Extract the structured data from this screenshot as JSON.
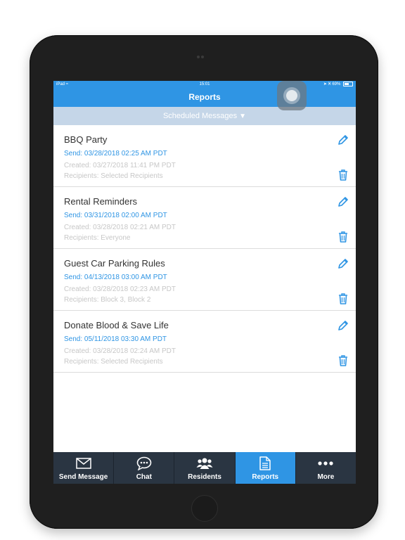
{
  "status_bar": {
    "left": "iPad",
    "time": "15:01",
    "battery": "69%"
  },
  "nav": {
    "title": "Reports"
  },
  "filter": {
    "label": "Scheduled Messages",
    "caret": "▼"
  },
  "messages": [
    {
      "title": "BBQ Party",
      "send": "Send: 03/28/2018 02:25 AM PDT",
      "created": "Created: 03/27/2018 11:41 PM PDT",
      "recipients": "Recipients: Selected Recipients"
    },
    {
      "title": "Rental Reminders",
      "send": "Send: 03/31/2018 02:00 AM PDT",
      "created": "Created: 03/28/2018 02:21 AM PDT",
      "recipients": "Recipients: Everyone"
    },
    {
      "title": "Guest Car Parking Rules",
      "send": "Send: 04/13/2018 03:00 AM PDT",
      "created": "Created: 03/28/2018 02:23 AM PDT",
      "recipients": "Recipients: Block 3, Block 2"
    },
    {
      "title": "Donate Blood & Save Life",
      "send": "Send: 05/11/2018 03:30 AM PDT",
      "created": "Created: 03/28/2018 02:24 AM PDT",
      "recipients": "Recipients: Selected Recipients"
    }
  ],
  "tabs": [
    {
      "label": "Send Message",
      "icon": "envelope-icon",
      "active": false
    },
    {
      "label": "Chat",
      "icon": "chat-bubble-icon",
      "active": false
    },
    {
      "label": "Residents",
      "icon": "people-icon",
      "active": false
    },
    {
      "label": "Reports",
      "icon": "document-icon",
      "active": true
    },
    {
      "label": "More",
      "icon": "more-dots-icon",
      "active": false
    }
  ],
  "colors": {
    "accent": "#2f95e4",
    "tab_bar": "#2a3542",
    "filter_bar": "#c5d6e8",
    "muted_text": "#c7c7c7"
  }
}
